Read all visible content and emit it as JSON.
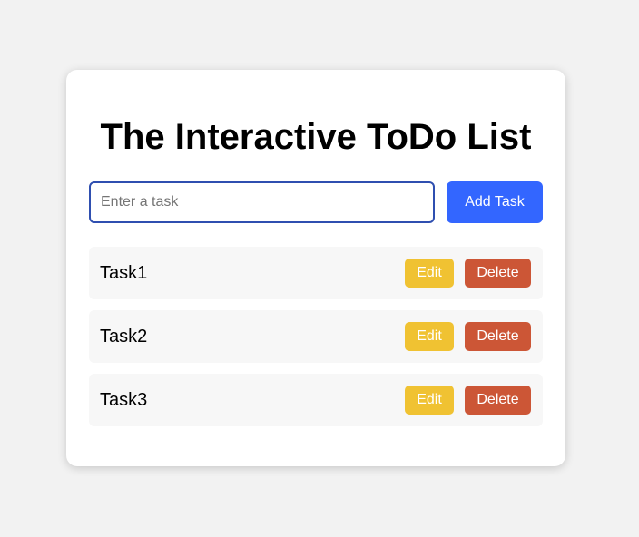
{
  "app": {
    "title": "The Interactive ToDo List"
  },
  "input": {
    "value": "",
    "placeholder": "Enter a task"
  },
  "add_button": {
    "label": "Add Task"
  },
  "tasks": [
    {
      "text": "Task1",
      "edit_label": "Edit",
      "delete_label": "Delete"
    },
    {
      "text": "Task2",
      "edit_label": "Edit",
      "delete_label": "Delete"
    },
    {
      "text": "Task3",
      "edit_label": "Edit",
      "delete_label": "Delete"
    }
  ],
  "colors": {
    "background": "#f2f2f2",
    "card": "#ffffff",
    "add_button": "#3366ff",
    "edit_button": "#f0c232",
    "delete_button": "#cc5636",
    "input_border": "#2f4fb0",
    "task_row": "#f7f7f7"
  }
}
